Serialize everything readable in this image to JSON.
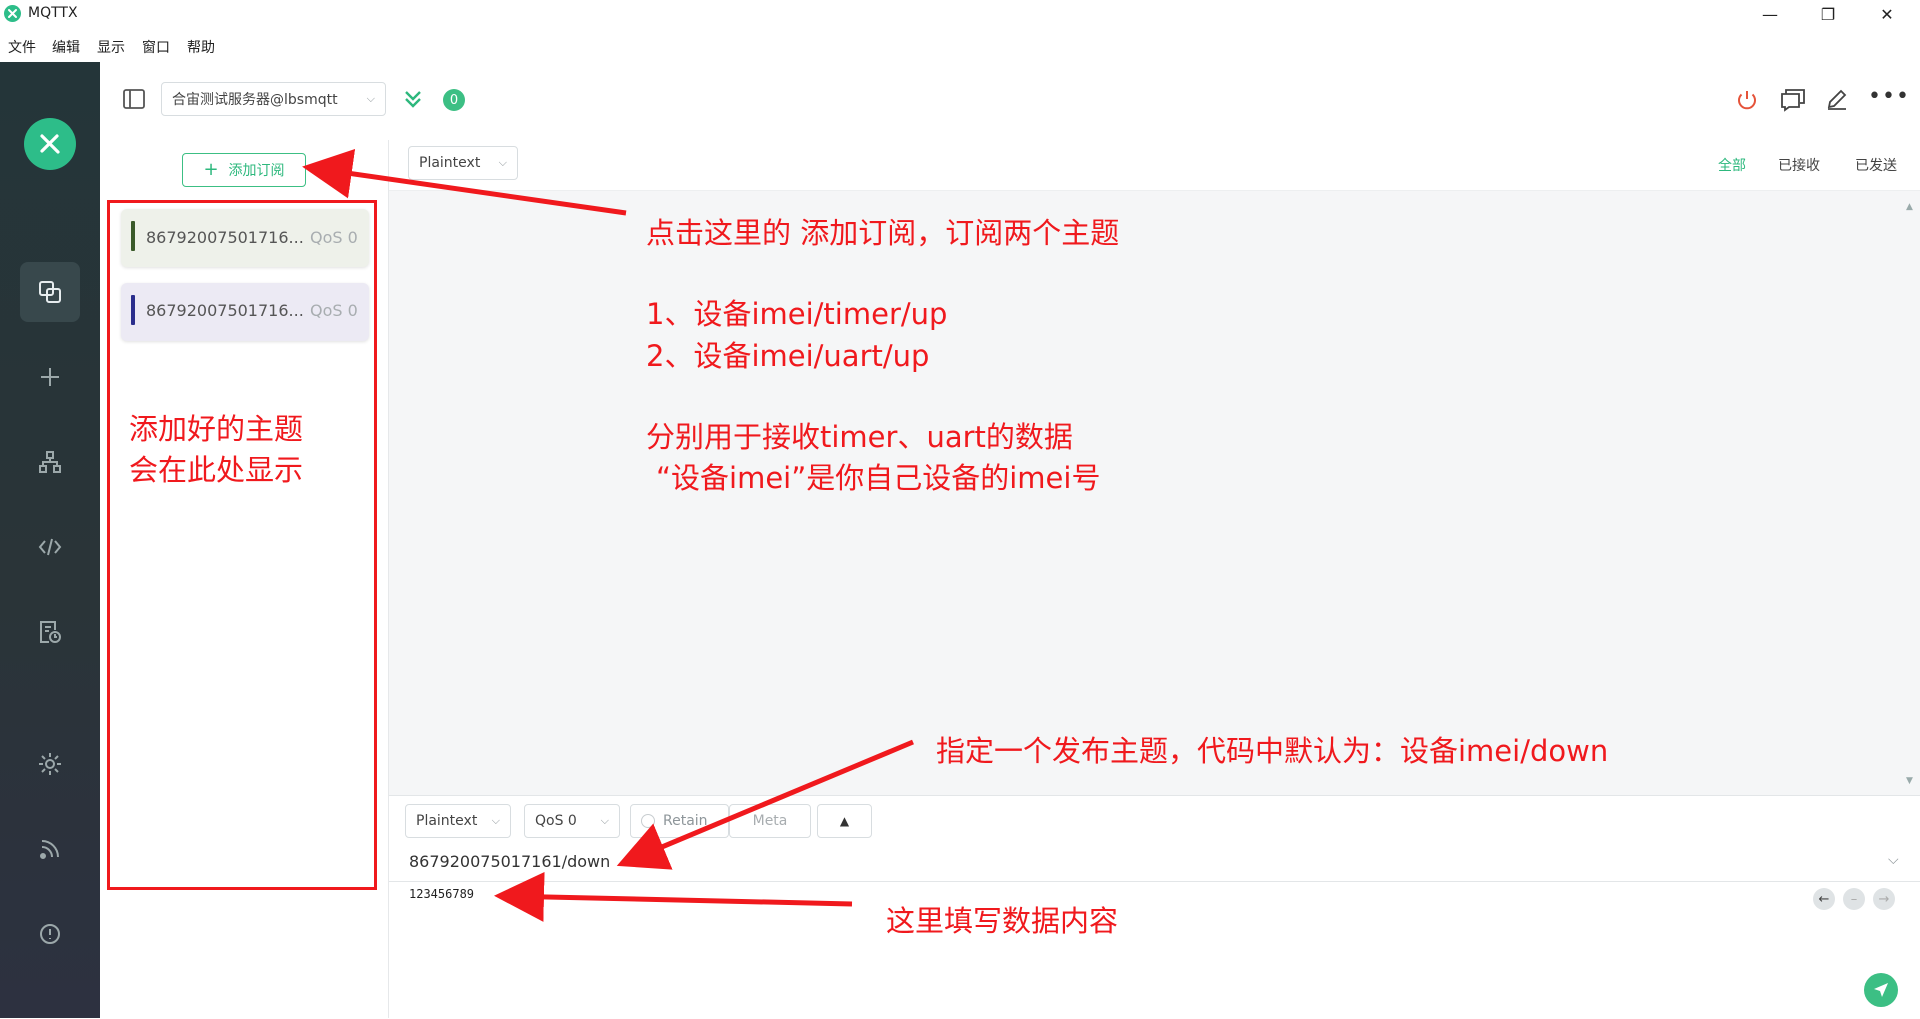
{
  "window": {
    "title": "MQTTX",
    "controls": [
      "—",
      "❐",
      "✕"
    ]
  },
  "menu": [
    "文件",
    "编辑",
    "显示",
    "窗口",
    "帮助"
  ],
  "rail": {
    "icons": [
      "connections-icon",
      "add-icon",
      "topology-icon",
      "code-icon",
      "log-icon",
      "settings-icon",
      "feed-icon",
      "about-icon"
    ]
  },
  "header": {
    "connection_name": "合宙测试服务器@lbsmqtt",
    "badge_count": "0"
  },
  "subscriptions": {
    "add_label": "添加订阅",
    "items": [
      {
        "topic": "86792007501716...",
        "qos": "QoS 0",
        "color": "#3a5a2a",
        "bg": "#eef1ea"
      },
      {
        "topic": "86792007501716...",
        "qos": "QoS 0",
        "color": "#2b2e8c",
        "bg": "#eceaf4"
      }
    ]
  },
  "messages": {
    "format": "Plaintext",
    "filters": {
      "all": "全部",
      "received": "已接收",
      "sent": "已发送"
    }
  },
  "publish": {
    "format": "Plaintext",
    "qos": "QoS 0",
    "retain": "Retain",
    "meta": "Meta",
    "topic": "867920075017161/down",
    "payload": "123456789"
  },
  "annotations": {
    "top_line1": "点击这里的 添加订阅，订阅两个主题",
    "top_line2": "1、设备imei/timer/up",
    "top_line3": "2、设备imei/uart/up",
    "top_line4": "分别用于接收timer、uart的数据",
    "top_line5": "“设备imei”是你自己设备的imei号",
    "left_line1": "添加好的主题",
    "left_line2": "会在此处显示",
    "publish_topic_note": "指定一个发布主题，代码中默认为：设备imei/down",
    "payload_note": "这里填写数据内容"
  },
  "colors": {
    "accent": "#2db87d",
    "annotation": "#f0191d",
    "power": "#e5533a"
  }
}
